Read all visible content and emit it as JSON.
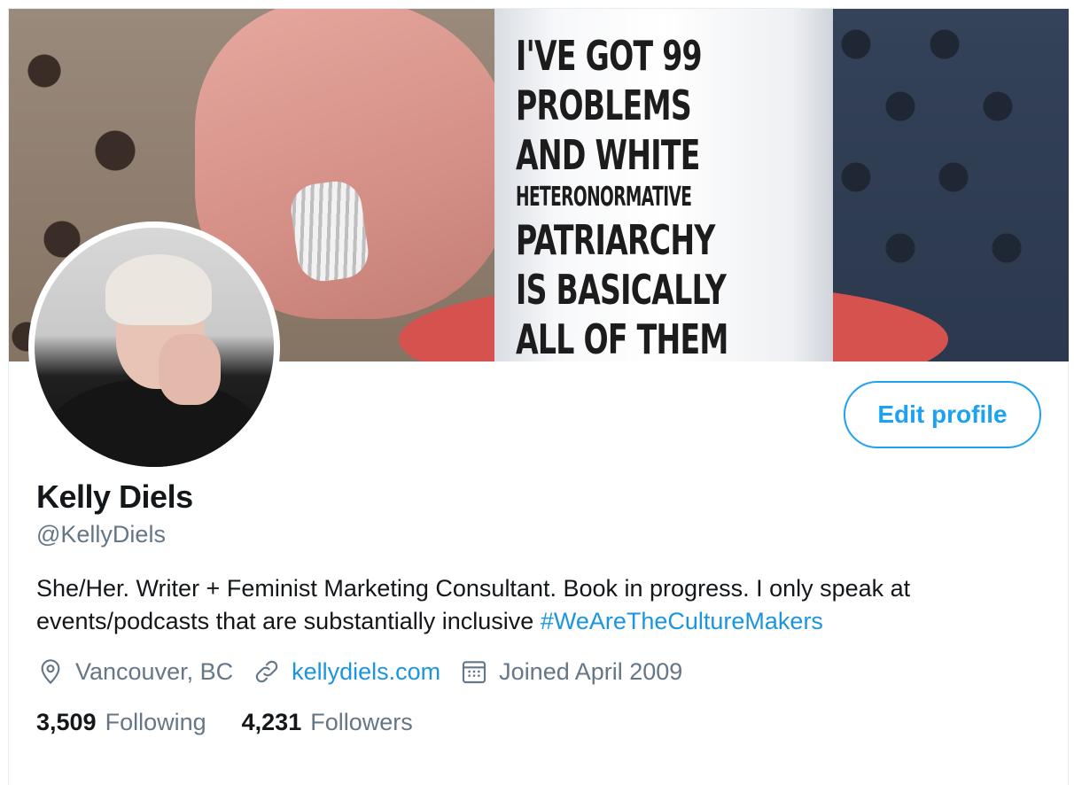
{
  "banner": {
    "mug_lines": [
      "I'VE GOT 99",
      "PROBLEMS",
      "AND WHITE",
      "HETERONORMATIVE",
      "PATRIARCHY",
      "IS BASICALLY",
      "ALL OF THEM"
    ]
  },
  "profile": {
    "edit_label": "Edit profile",
    "name": "Kelly Diels",
    "handle": "@KellyDiels",
    "bio_text": "She/Her. Writer + Feminist Marketing Consultant. Book in progress. I only speak at events/podcasts that are substantially inclusive ",
    "bio_hashtag": "#WeAreTheCultureMakers",
    "location": "Vancouver, BC",
    "website": "kellydiels.com",
    "joined": "Joined April 2009",
    "following_count": "3,509",
    "following_label": "Following",
    "followers_count": "4,231",
    "followers_label": "Followers"
  },
  "icons": {
    "location": "location-pin-icon",
    "link": "link-icon",
    "calendar": "calendar-icon"
  },
  "colors": {
    "accent": "#1da1f2",
    "link": "#1b95e0",
    "text_primary": "#14171a",
    "text_secondary": "#657786"
  }
}
